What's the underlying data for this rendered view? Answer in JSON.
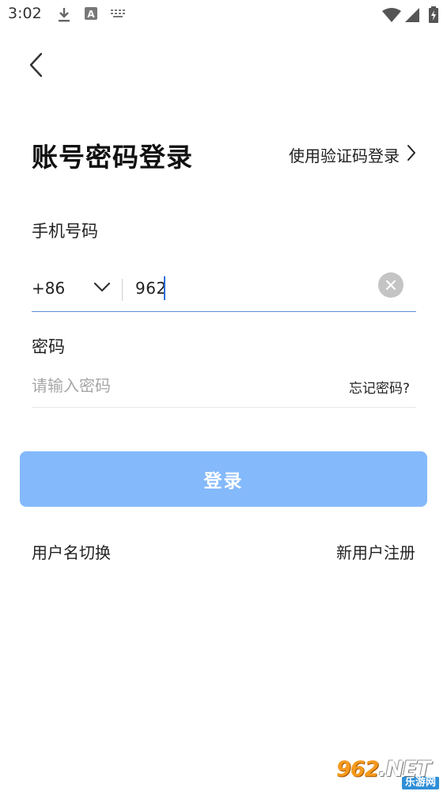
{
  "status_bar": {
    "time": "3:02",
    "left_icons": [
      "download-icon",
      "a-badge-icon",
      "keyboard-icon"
    ],
    "right_icons": [
      "wifi-icon",
      "signal-icon",
      "battery-icon"
    ]
  },
  "header": {
    "back_icon": "chevron-left-icon",
    "title": "账号密码登录",
    "switch_link": "使用验证码登录"
  },
  "phone": {
    "label": "手机号码",
    "country_code": "+86",
    "value": "962",
    "clear_icon": "clear-circle-icon"
  },
  "password": {
    "label": "密码",
    "placeholder": "请输入密码",
    "forgot_link": "忘记密码?"
  },
  "login_button": {
    "label": "登录"
  },
  "footer_links": {
    "switch_username": "用户名切换",
    "register": "新用户注册"
  },
  "watermark": {
    "brand": "962",
    "brand_suffix": ".NET",
    "sub": "乐游网"
  },
  "colors": {
    "accent": "#84b9fb",
    "field_focus_line": "#5b8fd6",
    "caret": "#2a6fd6",
    "watermark_orange": "#f59a1e"
  }
}
